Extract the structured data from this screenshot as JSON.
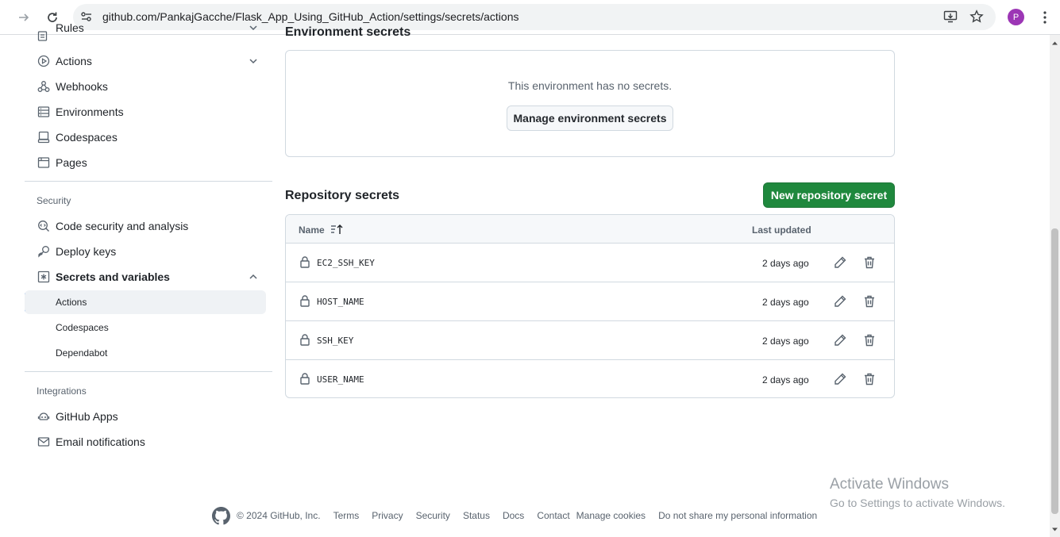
{
  "browser": {
    "url": "github.com/PankajGacche/Flask_App_Using_GitHub_Action/settings/secrets/actions",
    "avatar_letter": "P",
    "avatar_color": "#9c36b5"
  },
  "sidebar": {
    "items_top": [
      {
        "label": "Rules",
        "icon": "rules-icon"
      },
      {
        "label": "Actions",
        "icon": "play-icon"
      },
      {
        "label": "Webhooks",
        "icon": "webhook-icon"
      },
      {
        "label": "Environments",
        "icon": "server-icon"
      },
      {
        "label": "Codespaces",
        "icon": "codespaces-icon"
      },
      {
        "label": "Pages",
        "icon": "browser-icon"
      }
    ],
    "security_heading": "Security",
    "security_items": [
      {
        "label": "Code security and analysis",
        "icon": "codescan-icon"
      },
      {
        "label": "Deploy keys",
        "icon": "key-icon"
      },
      {
        "label": "Secrets and variables",
        "icon": "asterisk-icon"
      }
    ],
    "secrets_sub": [
      {
        "label": "Actions"
      },
      {
        "label": "Codespaces"
      },
      {
        "label": "Dependabot"
      }
    ],
    "integrations_heading": "Integrations",
    "integration_items": [
      {
        "label": "GitHub Apps",
        "icon": "apps-icon"
      },
      {
        "label": "Email notifications",
        "icon": "mail-icon"
      }
    ]
  },
  "main": {
    "env_heading": "Environment secrets",
    "env_message": "This environment has no secrets.",
    "manage_env_button": "Manage environment secrets",
    "repo_heading": "Repository secrets",
    "new_secret_button": "New repository secret",
    "table": {
      "col_name": "Name",
      "col_updated": "Last updated",
      "rows": [
        {
          "name": "EC2_SSH_KEY",
          "updated": "2 days ago"
        },
        {
          "name": "HOST_NAME",
          "updated": "2 days ago"
        },
        {
          "name": "SSH_KEY",
          "updated": "2 days ago"
        },
        {
          "name": "USER_NAME",
          "updated": "2 days ago"
        }
      ]
    }
  },
  "footer": {
    "copyright": "© 2024 GitHub, Inc.",
    "links": [
      "Terms",
      "Privacy",
      "Security",
      "Status",
      "Docs",
      "Contact",
      "Manage cookies",
      "Do not share my personal information"
    ]
  },
  "watermark": {
    "title": "Activate Windows",
    "subtitle": "Go to Settings to activate Windows."
  },
  "colors": {
    "primary_button": "#1f883d",
    "active_indicator": "#0969da"
  }
}
